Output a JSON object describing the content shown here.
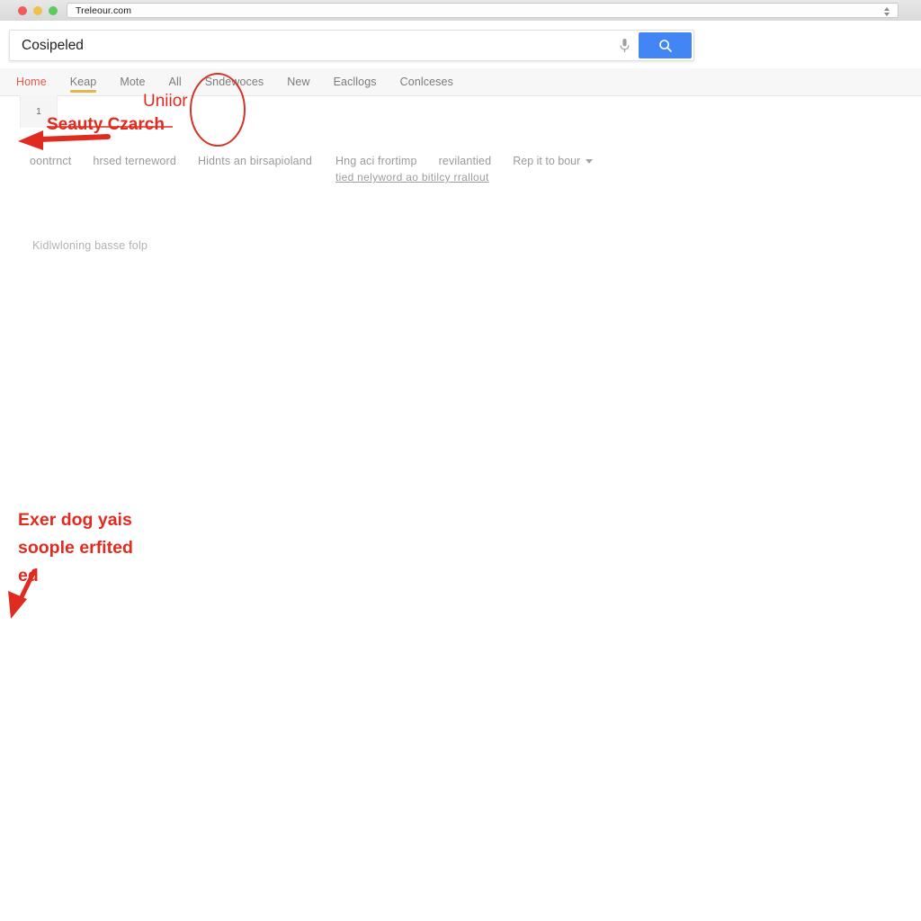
{
  "browser": {
    "url": "Treleour.com",
    "traffic_lights": [
      "close",
      "minimize",
      "maximize"
    ],
    "stepper_icon": "vertical-stepper-icon"
  },
  "search": {
    "value": "Cosipeled",
    "placeholder": "Cosipeled",
    "mic_icon": "microphone-icon",
    "button_icon": "search-icon",
    "button_color": "#4285f4"
  },
  "nav": {
    "tabs": [
      {
        "label": "Home",
        "state": "active-red"
      },
      {
        "label": "Keap",
        "state": "underlined"
      },
      {
        "label": "Mote",
        "state": "default"
      },
      {
        "label": "All",
        "state": "default"
      },
      {
        "label": "Sndewoces",
        "state": "default"
      },
      {
        "label": "New",
        "state": "default"
      },
      {
        "label": "Eacllogs",
        "state": "default"
      },
      {
        "label": "Conlceses",
        "state": "default"
      }
    ]
  },
  "results": {
    "page_chip": "1",
    "links": [
      "oontrnct",
      "hrsed terneword",
      "Hidnts an birsapioland",
      "Hng aci frortimp",
      "revilantied"
    ],
    "dropdown_label": "Rep it to bour",
    "dropdown_caret_icon": "chevron-down-icon",
    "sub_link": "tied nelyword ao bitilcy rrallout",
    "footer_note": "Kidlwloning basse folp"
  },
  "annotations": {
    "accent_color": "#e02b20",
    "uniior": "Uniior",
    "seauty_czarch": "Seauty Czarch",
    "block_line1": "Exer dog yais",
    "block_line2": "soople erfited",
    "block_line3": "ed",
    "circle_icon": "red-ellipse-highlight-icon",
    "arrow_left_icon": "red-left-arrow-icon",
    "arrow_down_icon": "red-down-left-arrow-icon"
  }
}
